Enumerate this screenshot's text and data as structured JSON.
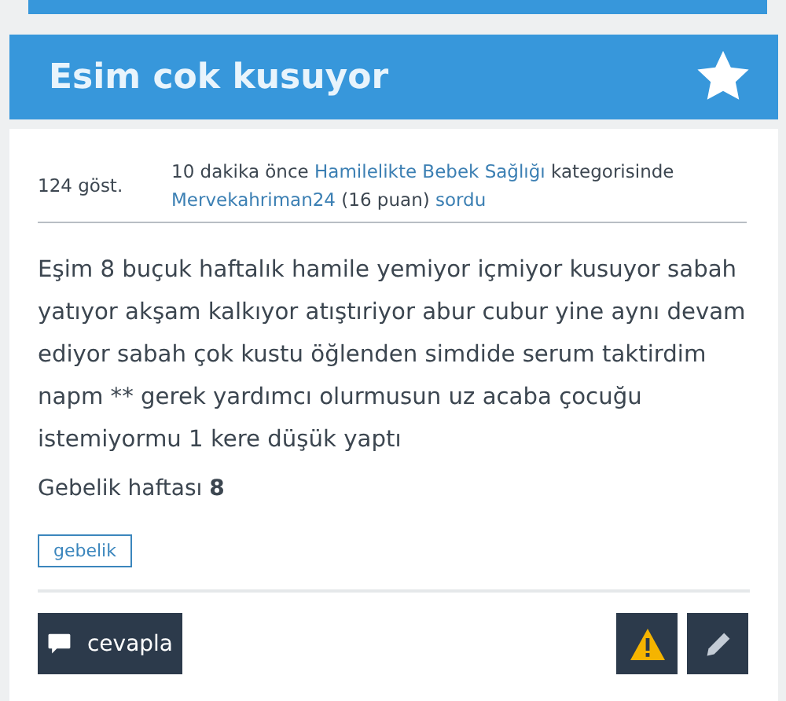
{
  "question": {
    "title": "Esim cok kusuyor"
  },
  "meta": {
    "views": "124 göst.",
    "time": "10 dakika önce",
    "category": "Hamilelikte Bebek Sağlığı",
    "category_suffix": "kategorisinde",
    "user": "Mervekahriman24",
    "points": "(16 puan)",
    "action": "sordu"
  },
  "body": "Eşim 8 buçuk haftalık hamile yemiyor içmiyor kusuyor sabah yatıyor akşam kalkıyor atıştıriyor abur cubur yine aynı devam ediyor sabah çok kustu öğlenden simdide serum taktirdim napm ** gerek yardımcı olurmusun uz acaba çocuğu istemiyormu 1 kere düşük yaptı",
  "pregnancy_week": "Gebelik haftası **8**",
  "tags": [
    "gebelik"
  ],
  "actions": {
    "answer": "cevapla"
  }
}
